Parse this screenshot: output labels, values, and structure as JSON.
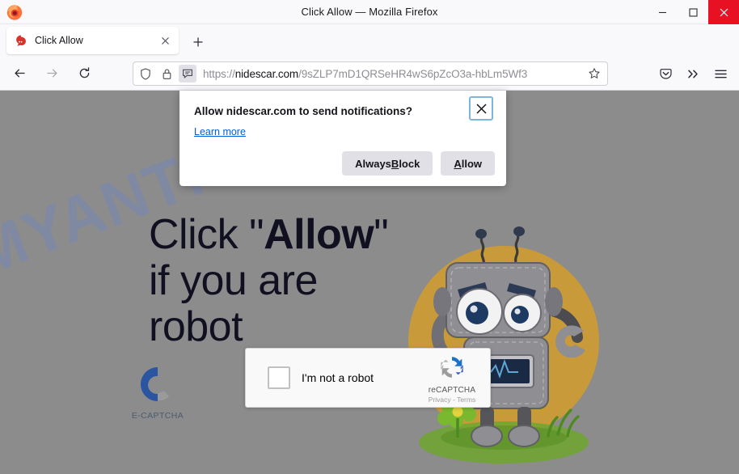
{
  "window": {
    "title": "Click Allow — Mozilla Firefox",
    "minimize_label": "Minimize",
    "maximize_label": "Maximize",
    "close_label": "Close"
  },
  "tabs": {
    "items": [
      {
        "label": "Click Allow",
        "close_label": "×",
        "favicon": "firefox-favicon"
      }
    ],
    "new_tab_label": "+"
  },
  "toolbar": {
    "back_label": "Back",
    "forward_label": "Forward",
    "reload_label": "Reload",
    "pocket_label": "Save to Pocket",
    "overflow_label": "»",
    "menu_label": "Open application menu"
  },
  "urlbar": {
    "scheme": "https://",
    "host": "nidescar.com",
    "path": "/9sZLP7mD1QRSeHR4wS6pZcO3a-hbLm5Wf3",
    "full": "https://nidescar.com/9sZLP7mD1QRSeHR4wS6pZcO3a-hbLm5Wf3",
    "shield_icon": "shield-icon",
    "lock_icon": "lock-icon",
    "permission_icon": "notification-permission-icon",
    "bookmark_icon": "star-icon"
  },
  "notification_dialog": {
    "title": "Allow nidescar.com to send notifications?",
    "learn_more": "Learn more",
    "block_label_pre": "Always ",
    "block_label_key": "B",
    "block_label_post": "lock",
    "allow_label_key": "A",
    "allow_label_post": "llow",
    "close_icon": "close-icon"
  },
  "page": {
    "watermark": "MYANTISPYWARE.COM",
    "heading_pre": "Click \"",
    "heading_bold": "Allow",
    "heading_post": "\" if you are robot",
    "background_color": "#8c8c8c",
    "ecaptcha": {
      "label": "E-CAPTCHA",
      "logo_icon": "ecaptcha-c-logo-icon",
      "blue": "#2b55a0",
      "gray": "#9a9a9a"
    },
    "recaptcha": {
      "checkbox_label": "I'm not a robot",
      "brand": "reCAPTCHA",
      "terms": "Privacy - Terms",
      "logo_icon": "recaptcha-logo-icon",
      "checked": false
    },
    "robot": {
      "alt": "cartoon gray robot holding wrench on orange circle",
      "circle_color": "#c99a3a",
      "body_color": "#8e8e93",
      "grass_color": "#6ea62f"
    }
  }
}
